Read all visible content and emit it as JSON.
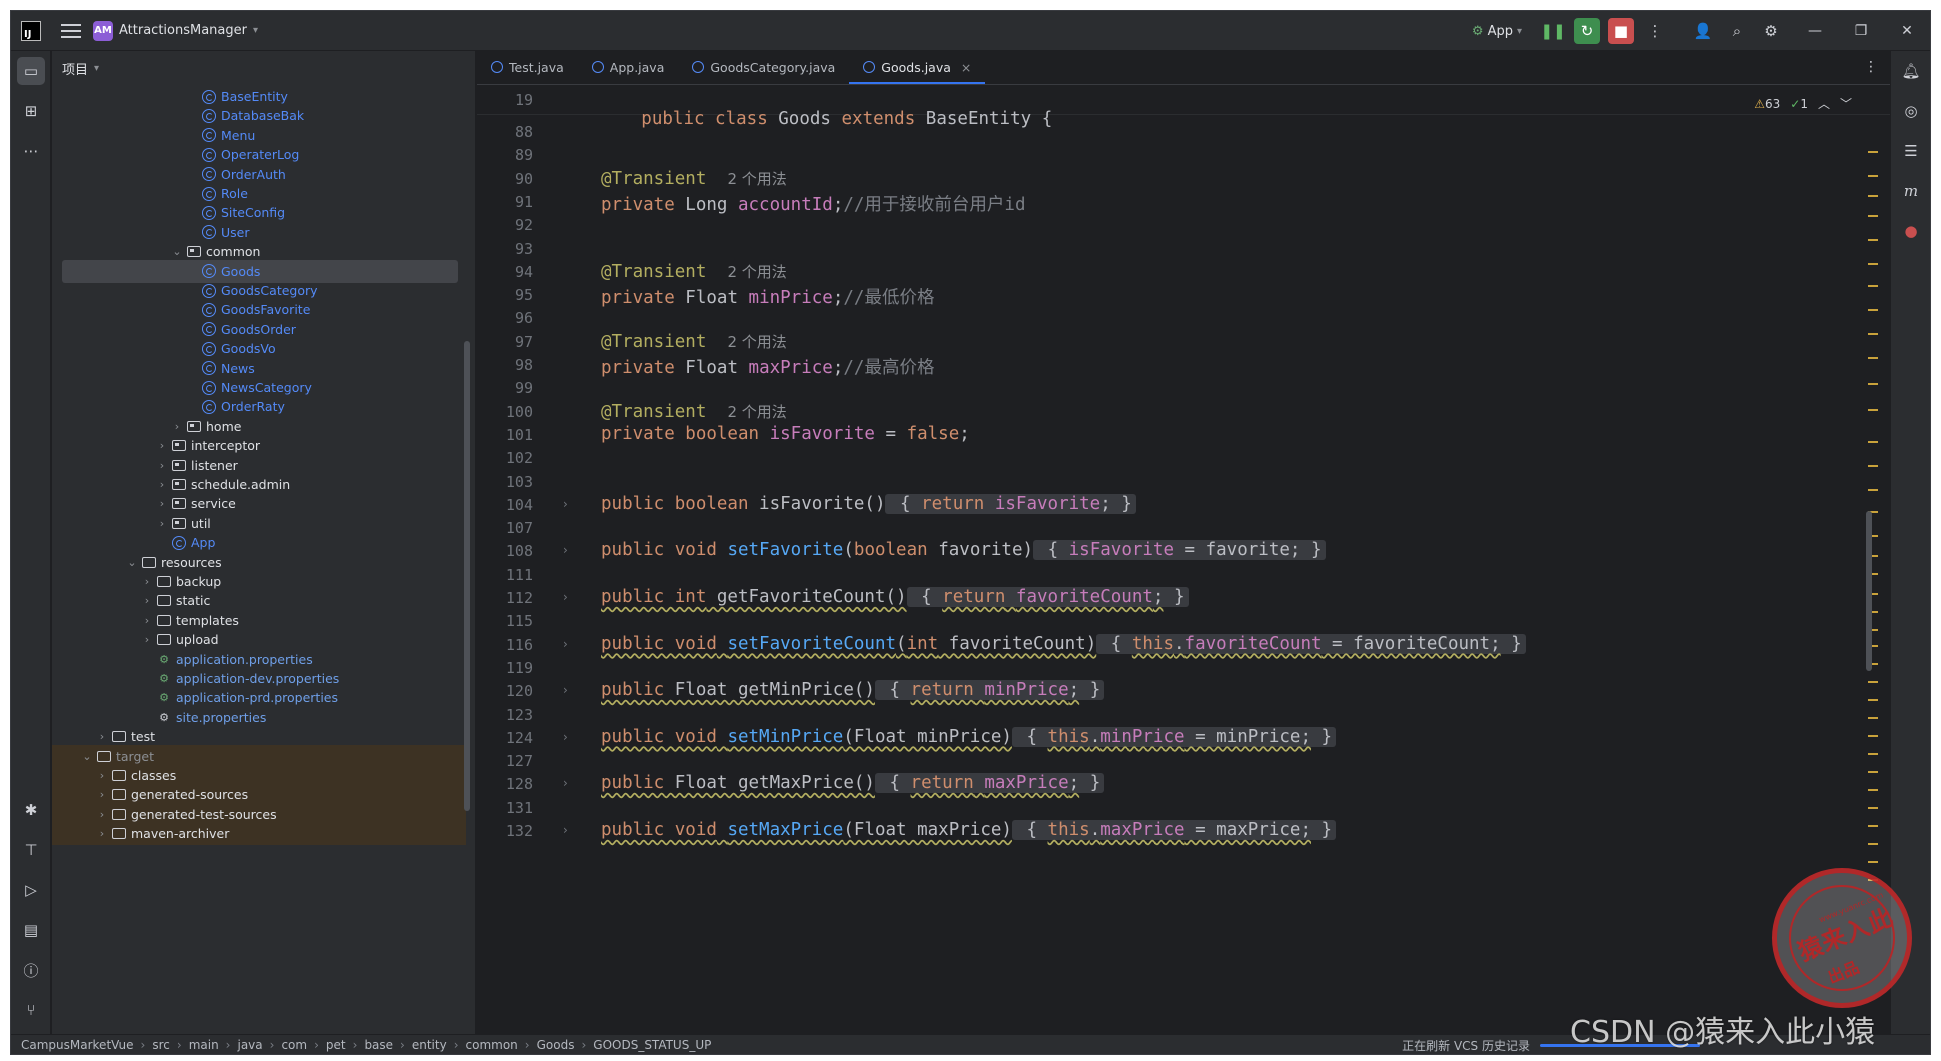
{
  "titlebar": {
    "project_badge": "AM",
    "project_name": "AttractionsManager",
    "run_config": "App"
  },
  "project_panel": {
    "title": "项目",
    "tree": [
      {
        "label": "BaseEntity",
        "type": "class",
        "indent": 8
      },
      {
        "label": "DatabaseBak",
        "type": "class",
        "indent": 8
      },
      {
        "label": "Menu",
        "type": "class",
        "indent": 8
      },
      {
        "label": "OperaterLog",
        "type": "class",
        "indent": 8
      },
      {
        "label": "OrderAuth",
        "type": "class",
        "indent": 8
      },
      {
        "label": "Role",
        "type": "class",
        "indent": 8
      },
      {
        "label": "SiteConfig",
        "type": "class",
        "indent": 8
      },
      {
        "label": "User",
        "type": "class",
        "indent": 8
      },
      {
        "label": "common",
        "type": "package",
        "indent": 7,
        "expanded": true
      },
      {
        "label": "Goods",
        "type": "class",
        "indent": 8,
        "selected": true
      },
      {
        "label": "GoodsCategory",
        "type": "class",
        "indent": 8
      },
      {
        "label": "GoodsFavorite",
        "type": "class",
        "indent": 8
      },
      {
        "label": "GoodsOrder",
        "type": "class",
        "indent": 8
      },
      {
        "label": "GoodsVo",
        "type": "class",
        "indent": 8
      },
      {
        "label": "News",
        "type": "class",
        "indent": 8
      },
      {
        "label": "NewsCategory",
        "type": "class",
        "indent": 8
      },
      {
        "label": "OrderRaty",
        "type": "class",
        "indent": 8
      },
      {
        "label": "home",
        "type": "package",
        "indent": 7
      },
      {
        "label": "interceptor",
        "type": "package",
        "indent": 6
      },
      {
        "label": "listener",
        "type": "package",
        "indent": 6
      },
      {
        "label": "schedule.admin",
        "type": "package",
        "indent": 6
      },
      {
        "label": "service",
        "type": "package",
        "indent": 6
      },
      {
        "label": "util",
        "type": "package",
        "indent": 6
      },
      {
        "label": "App",
        "type": "app",
        "indent": 6
      },
      {
        "label": "resources",
        "type": "folder",
        "indent": 4,
        "expanded": true
      },
      {
        "label": "backup",
        "type": "folder",
        "indent": 5
      },
      {
        "label": "static",
        "type": "folder",
        "indent": 5
      },
      {
        "label": "templates",
        "type": "folder",
        "indent": 5
      },
      {
        "label": "upload",
        "type": "folder",
        "indent": 5
      },
      {
        "label": "application.properties",
        "type": "prop",
        "indent": 5
      },
      {
        "label": "application-dev.properties",
        "type": "prop",
        "indent": 5
      },
      {
        "label": "application-prd.properties",
        "type": "prop",
        "indent": 5
      },
      {
        "label": "site.properties",
        "type": "settings",
        "indent": 5
      },
      {
        "label": "test",
        "type": "folder",
        "indent": 2
      },
      {
        "label": "target",
        "type": "folder",
        "indent": 1,
        "expanded": true,
        "excluded": true
      },
      {
        "label": "classes",
        "type": "folder",
        "indent": 2,
        "excluded": true
      },
      {
        "label": "generated-sources",
        "type": "folder",
        "indent": 2,
        "excluded": true
      },
      {
        "label": "generated-test-sources",
        "type": "folder",
        "indent": 2,
        "excluded": true
      },
      {
        "label": "maven-archiver",
        "type": "folder",
        "indent": 2,
        "excluded": true
      }
    ]
  },
  "editor": {
    "tabs": [
      {
        "label": "Test.java",
        "active": false
      },
      {
        "label": "App.java",
        "active": false
      },
      {
        "label": "GoodsCategory.java",
        "active": false
      },
      {
        "label": "Goods.java",
        "active": true
      }
    ],
    "inspection": {
      "warnings": "63",
      "weak_warnings": "1"
    },
    "sticky_line": {
      "number": "19",
      "text": "public class Goods extends BaseEntity {"
    },
    "lines": [
      {
        "n": "88",
        "html": ""
      },
      {
        "n": "89",
        "html": ""
      },
      {
        "n": "90",
        "html": "<span class='ann'>@Transient</span>  <span class='hint'>2 个用法</span>"
      },
      {
        "n": "91",
        "html": "<span class='kw'>private</span> Long <span class='fld'>accountId</span>;<span class='cmt'>//用于接收前台用户id</span>"
      },
      {
        "n": "92",
        "html": ""
      },
      {
        "n": "93",
        "html": ""
      },
      {
        "n": "94",
        "html": "<span class='ann'>@Transient</span>  <span class='hint'>2 个用法</span>"
      },
      {
        "n": "95",
        "html": "<span class='kw'>private</span> Float <span class='fld'>minPrice</span>;<span class='cmt'>//最低价格</span>"
      },
      {
        "n": "96",
        "html": ""
      },
      {
        "n": "97",
        "html": "<span class='ann'>@Transient</span>  <span class='hint'>2 个用法</span>"
      },
      {
        "n": "98",
        "html": "<span class='kw'>private</span> Float <span class='fld'>maxPrice</span>;<span class='cmt'>//最高价格</span>"
      },
      {
        "n": "99",
        "html": ""
      },
      {
        "n": "100",
        "html": "<span class='ann'>@Transient</span>  <span class='hint'>2 个用法</span>"
      },
      {
        "n": "101",
        "html": "<span class='kw'>private boolean</span> <span class='fld'>isFavorite</span> = <span class='kw'>false</span>;"
      },
      {
        "n": "102",
        "html": ""
      },
      {
        "n": "103",
        "html": ""
      },
      {
        "n": "104",
        "html": "<span class='kw'>public boolean</span> isFavorite()<span class='fold'> { <span class='kw'>return</span> <span class='fld'>isFavorite</span>; }</span>",
        "fold": true
      },
      {
        "n": "107",
        "html": ""
      },
      {
        "n": "108",
        "html": "<span class='kw'>public void</span> <span class='mth'>setFavorite</span>(<span class='kw'>boolean</span> favorite)<span class='fold'> { <span class='fld'>isFavorite</span> = favorite; }</span>",
        "fold": true
      },
      {
        "n": "111",
        "html": ""
      },
      {
        "n": "112",
        "html": "<span class='wavy'><span class='kw'>public int</span> getFavoriteCount()</span><span class='fold'> { <span class='wavy'><span class='kw'>return</span> <span class='fld'>favoriteCount</span>;</span> }</span>",
        "fold": true
      },
      {
        "n": "115",
        "html": ""
      },
      {
        "n": "116",
        "html": "<span class='wavy'><span class='kw'>public void</span> <span class='mth'>setFavoriteCount</span>(<span class='kw'>int</span> favoriteCount)</span><span class='fold'> { <span class='wavy'><span class='kw'>this</span>.<span class='fld'>favoriteCount</span> = favoriteCount;</span> }</span>",
        "fold": true
      },
      {
        "n": "119",
        "html": ""
      },
      {
        "n": "120",
        "html": "<span class='wavy'><span class='kw'>public</span> Float getMinPrice()</span><span class='fold'> { <span class='wavy'><span class='kw'>return</span> <span class='fld'>minPrice</span>;</span> }</span>",
        "fold": true
      },
      {
        "n": "123",
        "html": ""
      },
      {
        "n": "124",
        "html": "<span class='wavy'><span class='kw'>public void</span> <span class='mth'>setMinPrice</span>(Float minPrice)</span><span class='fold'> { <span class='wavy'><span class='kw'>this</span>.<span class='fld'>minPrice</span> = minPrice;</span> }</span>",
        "fold": true
      },
      {
        "n": "127",
        "html": ""
      },
      {
        "n": "128",
        "html": "<span class='wavy'><span class='kw'>public</span> Float getMaxPrice()</span><span class='fold'> { <span class='wavy'><span class='kw'>return</span> <span class='fld'>maxPrice</span>;</span> }</span>",
        "fold": true
      },
      {
        "n": "131",
        "html": ""
      },
      {
        "n": "132",
        "html": "<span class='wavy'><span class='kw'>public void</span> <span class='mth'>setMaxPrice</span>(Float maxPrice)</span><span class='fold'> { <span class='wavy'><span class='kw'>this</span>.<span class='fld'>maxPrice</span> = maxPrice;</span> }</span>",
        "fold": true
      }
    ]
  },
  "statusbar": {
    "breadcrumb": [
      "CampusMarketVue",
      "src",
      "main",
      "java",
      "com",
      "pet",
      "base",
      "entity",
      "common",
      "Goods",
      "GOODS_STATUS_UP"
    ],
    "task": "正在刷新 VCS 历史记录"
  },
  "watermark": {
    "csdn": "CSDN @猿来入此小猿",
    "seal_main": "猿来入此",
    "seal_sub": "出品",
    "seal_url": "www.yuanrc.com"
  }
}
